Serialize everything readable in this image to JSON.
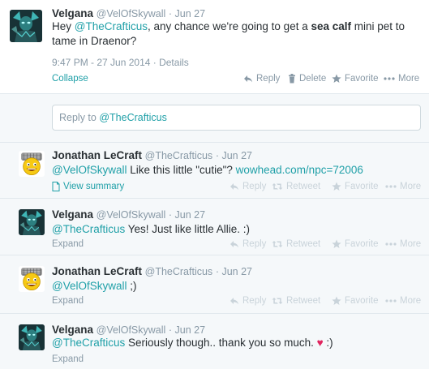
{
  "main_tweet": {
    "name": "Velgana",
    "handle": "@VelOfSkywall",
    "date": "· Jun 27",
    "text_pre": "Hey ",
    "mention": "@TheCrafticus",
    "text_mid": ", any chance we're going to get a ",
    "text_bold": "sea calf",
    "text_post": " mini pet to tame in Draenor?",
    "timestamp": "9:47 PM - 27 Jun 2014",
    "details_label": "· Details",
    "collapse_label": "Collapse",
    "actions": {
      "reply": "Reply",
      "delete": "Delete",
      "favorite": "Favorite",
      "more": "More"
    }
  },
  "reply_box": {
    "prefix": "Reply to ",
    "mention": "@TheCrafticus"
  },
  "replies": [
    {
      "name": "Jonathan LeCraft",
      "handle": "@TheCrafticus",
      "date": "· Jun 27",
      "mention": "@VelOfSkywall",
      "text": " Like this little \"cutie\"? ",
      "link": "wowhead.com/npc=72006",
      "footer": "View summary",
      "actions": {
        "reply": "Reply",
        "retweet": "Retweet",
        "favorite": "Favorite",
        "more": "More"
      }
    },
    {
      "name": "Velgana",
      "handle": "@VelOfSkywall",
      "date": "· Jun 27",
      "mention": "@TheCrafticus",
      "text": " Yes! Just like little Allie. :)",
      "footer": "Expand",
      "actions": {
        "reply": "Reply",
        "retweet": "Retweet",
        "favorite": "Favorite",
        "more": "More"
      }
    },
    {
      "name": "Jonathan LeCraft",
      "handle": "@TheCrafticus",
      "date": "· Jun 27",
      "mention": "@VelOfSkywall",
      "text": " ;)",
      "footer": "Expand",
      "actions": {
        "reply": "Reply",
        "retweet": "Retweet",
        "favorite": "Favorite",
        "more": "More"
      }
    },
    {
      "name": "Velgana",
      "handle": "@VelOfSkywall",
      "date": "· Jun 27",
      "mention": "@TheCrafticus",
      "text": " Seriously though.. thank you so much. ",
      "heart": "♥",
      "text_end": " :)",
      "footer": "Expand",
      "actions": {
        "reply": "Reply",
        "retweet": "Retweet",
        "favorite": "Favorite",
        "more": "More"
      }
    }
  ],
  "colors": {
    "link": "#20a0a8",
    "muted": "#8899a6",
    "heart": "#e0245e",
    "reply_bg": "#f5f8fa"
  },
  "icons": [
    "reply-icon",
    "trash-icon",
    "star-icon",
    "more-icon",
    "retweet-icon",
    "document-icon"
  ]
}
